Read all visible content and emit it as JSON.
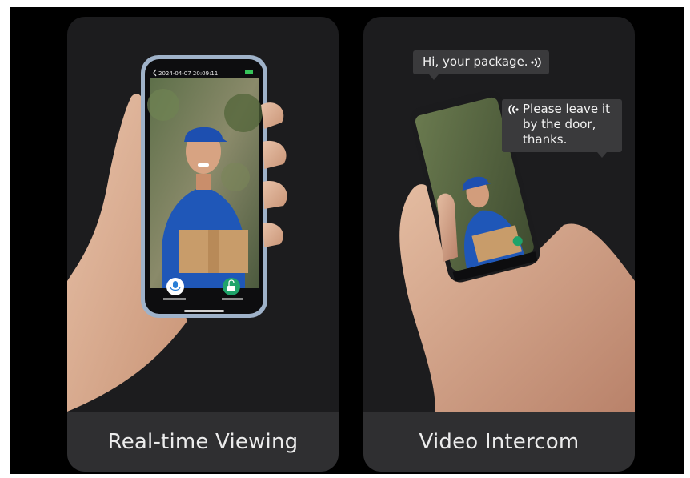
{
  "cards": [
    {
      "caption": "Real-time Viewing",
      "phone_screen": {
        "timestamp": "2024-04-07 20:09:11"
      }
    },
    {
      "caption": "Video Intercom",
      "bubbles": [
        {
          "text": "Hi, your package."
        },
        {
          "text": "Please leave it\nby the door,\nthanks."
        }
      ]
    }
  ],
  "colors": {
    "card_bg": "#1c1c1e",
    "caption_bar": "#2f2f31",
    "bubble_bg": "#3a3a3c",
    "shirt_blue": "#1f57b8",
    "unlock_green": "#1fa36a"
  },
  "icons": [
    "microphone-icon",
    "unlock-icon",
    "back-chevron-icon",
    "speaker-wave-icon",
    "incoming-wave-icon"
  ]
}
